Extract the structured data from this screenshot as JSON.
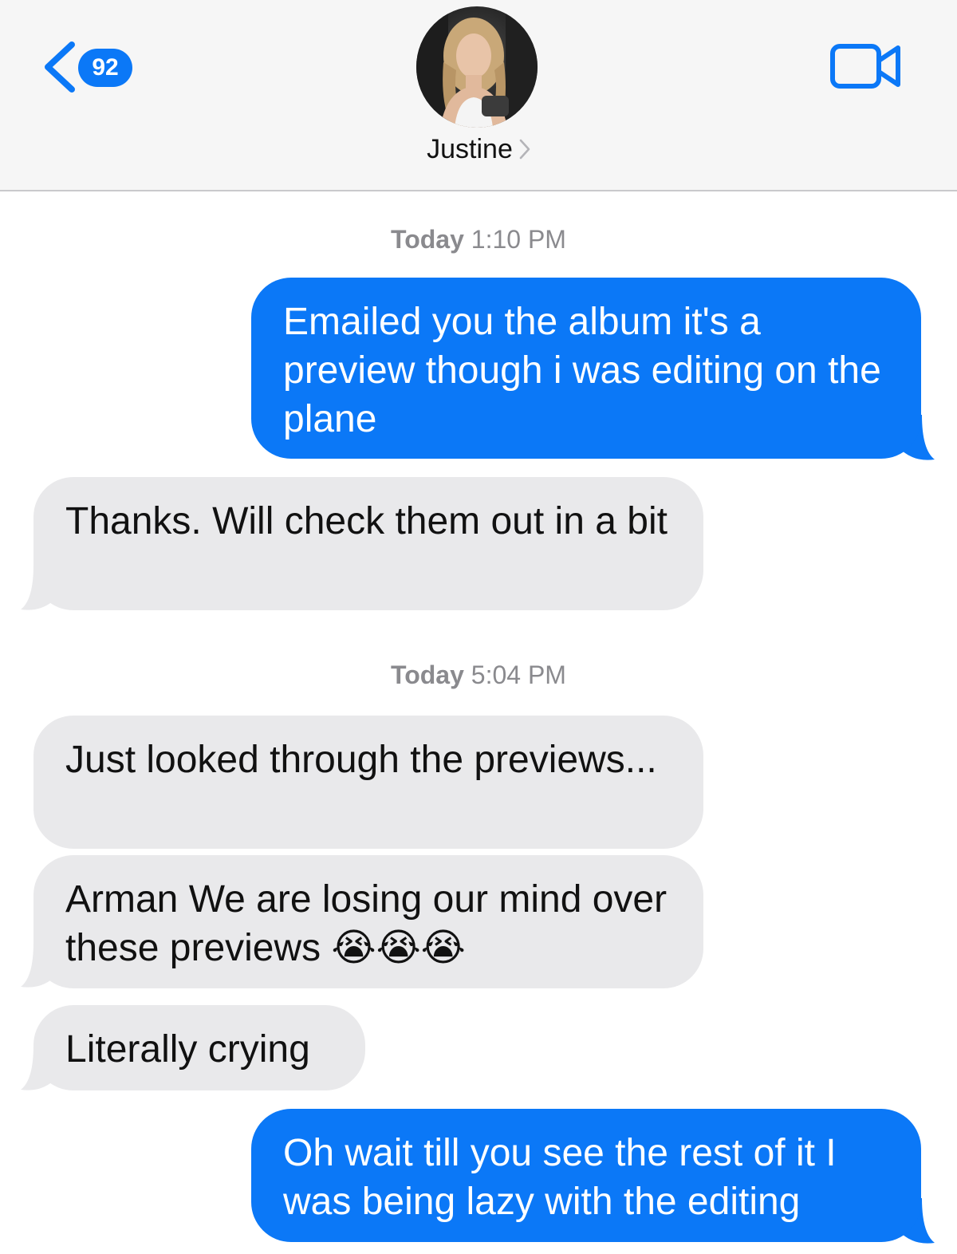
{
  "header": {
    "back_count": "92",
    "contact_name": "Justine"
  },
  "colors": {
    "accent": "#0b78f7",
    "sent_bubble": "#0b78f7",
    "received_bubble": "#e9e9eb",
    "header_bg": "#f6f6f6",
    "timestamp_text": "#8a8a8e"
  },
  "icons": {
    "back": "chevron-left-icon",
    "video": "video-camera-icon",
    "contact_disclosure": "chevron-right-icon"
  },
  "conversation": {
    "groups": [
      {
        "day": "Today",
        "time": "1:10 PM",
        "messages": [
          {
            "direction": "sent",
            "text": "Emailed you the album it's a preview though i was editing on the plane"
          },
          {
            "direction": "received",
            "text": "Thanks. Will check them out in a bit"
          }
        ]
      },
      {
        "day": "Today",
        "time": "5:04 PM",
        "messages": [
          {
            "direction": "received",
            "text": "Just looked through the previews..."
          },
          {
            "direction": "received",
            "text": "Arman We are losing our mind over these previews 😭😭😭"
          },
          {
            "direction": "received",
            "text": "Literally crying"
          },
          {
            "direction": "sent",
            "text": "Oh wait till you see the rest of it I was being lazy with the editing"
          }
        ]
      }
    ]
  }
}
